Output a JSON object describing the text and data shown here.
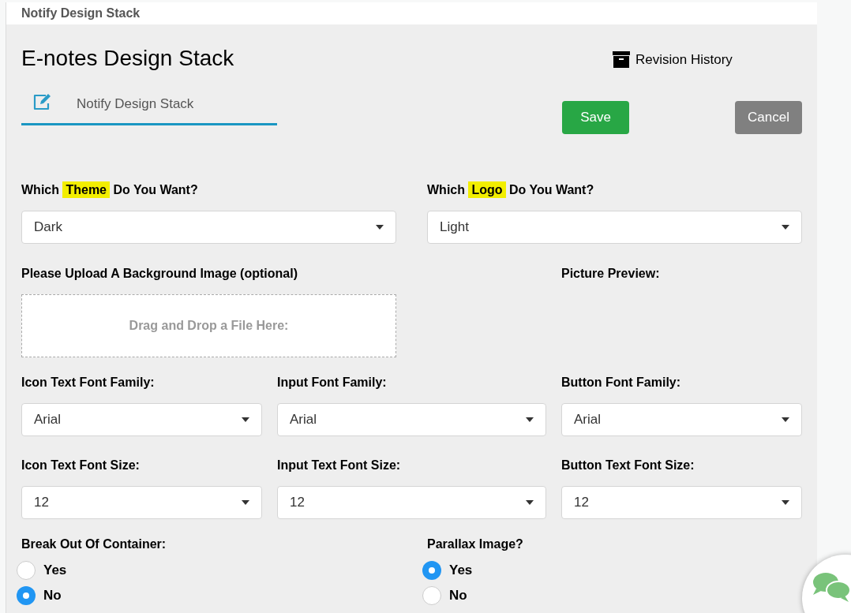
{
  "header": {
    "title": "Notify Design Stack"
  },
  "page_title": "E-notes Design Stack",
  "revision_link": "Revision History",
  "name_field": {
    "value": "Notify Design Stack"
  },
  "buttons": [
    {
      "label": "Save",
      "kind": "primary"
    },
    {
      "label": "Cancel",
      "kind": "secondary"
    }
  ],
  "choice_selects": [
    {
      "label": [
        {
          "text": "Which ",
          "highlighted": false
        },
        {
          "text": "Theme",
          "highlighted": true
        },
        {
          "text": " Do You Want?",
          "highlighted": false
        }
      ],
      "value": "Dark"
    },
    {
      "label": [
        {
          "text": "Which ",
          "highlighted": false
        },
        {
          "text": "Logo",
          "highlighted": true
        },
        {
          "text": " Do You Want?",
          "highlighted": false
        }
      ],
      "value": "Light"
    }
  ],
  "upload": {
    "label": "Please Upload A Background Image (optional)",
    "drop_text": "Drag and Drop a File Here:"
  },
  "preview_label": "Picture Preview:",
  "font_family_selects": [
    {
      "label": "Icon Text Font Family:",
      "value": "Arial"
    },
    {
      "label": "Input Font Family:",
      "value": "Arial"
    },
    {
      "label": "Button Font Family:",
      "value": "Arial"
    }
  ],
  "font_size_selects": [
    {
      "label": "Icon Text Font Size:",
      "value": "12"
    },
    {
      "label": "Input Text Font Size:",
      "value": "12"
    },
    {
      "label": "Button Text Font Size:",
      "value": "12"
    }
  ],
  "radio_groups": [
    {
      "label": "Break Out Of Container:",
      "options": [
        {
          "label": "Yes",
          "selected": false
        },
        {
          "label": "No",
          "selected": true
        }
      ]
    },
    {
      "label": "Parallax Image?",
      "options": [
        {
          "label": "Yes",
          "selected": true
        },
        {
          "label": "No",
          "selected": false
        }
      ]
    }
  ]
}
